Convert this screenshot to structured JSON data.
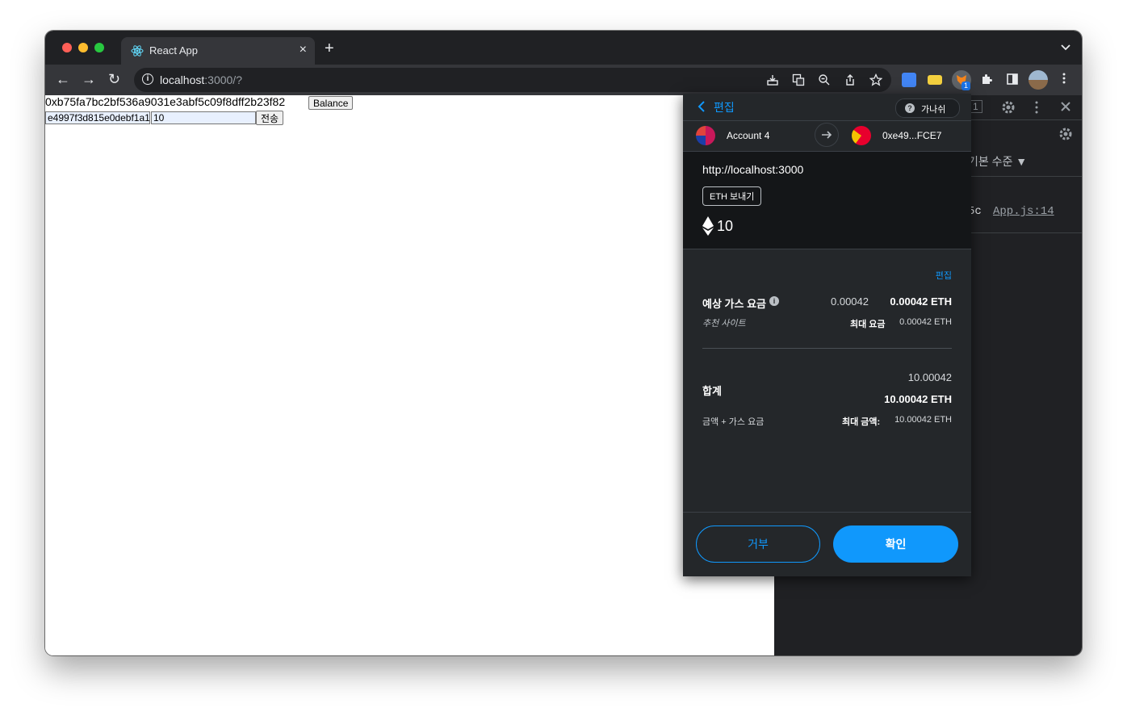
{
  "browser": {
    "tab_title": "React App",
    "tab_close": "×",
    "new_tab": "+",
    "tab_menu": "⌄",
    "url_host": "localhost",
    "url_path": ":3000/?",
    "nav": {
      "back": "←",
      "forward": "→",
      "reload": "↻"
    },
    "extension_badge": "1"
  },
  "page": {
    "account_address": "0xb75fa7bc2bf536a9031e3abf5c09f8dff2b23f82",
    "balance_button": "Balance",
    "to_address_value": "e4997f3d815e0debf1a1",
    "amount_value": "10",
    "send_button": "전송"
  },
  "devtools": {
    "tab_count": "1",
    "level_filter": "기본 수준 ▼",
    "log_text": "5c",
    "log_source": "App.js:14"
  },
  "metamask": {
    "back_label": "편집",
    "guide_label": "가나쉬",
    "from_account": "Account 4",
    "to_account": "0xe49...FCE7",
    "origin": "http://localhost:3000",
    "action_pill": "ETH 보내기",
    "amount": "10",
    "edit_link": "편집",
    "gas_label": "예상 가스 요금",
    "gas_value_plain": "0.00042",
    "gas_value_bold": "0.00042 ETH",
    "recommended_label": "추천 사이트",
    "max_fee_label": "최대 요금",
    "max_fee_value": "0.00042 ETH",
    "total_label": "합계",
    "total_plain": "10.00042",
    "total_bold": "10.00042 ETH",
    "amount_plus_gas_label": "금액 + 가스 요금",
    "max_amount_label": "최대 금액:",
    "max_amount_value": "10.00042 ETH",
    "reject_button": "거부",
    "confirm_button": "확인"
  }
}
